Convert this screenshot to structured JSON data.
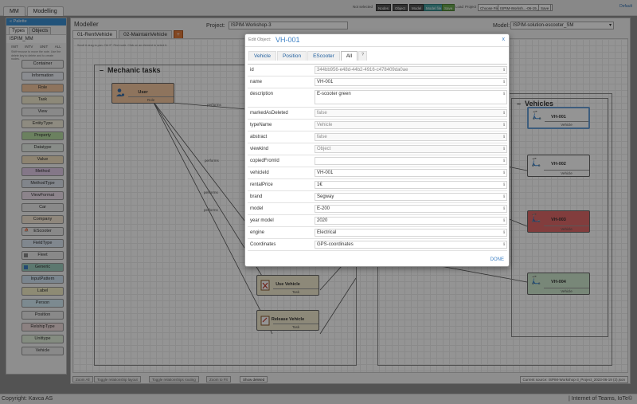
{
  "topbar": {
    "status": "Not selected",
    "buttons": [
      "Nodes",
      "Object",
      "Model",
      "Model file",
      "Save"
    ],
    "extras": [
      "Load",
      "Project",
      "Choose File"
    ],
    "file": "ISPIM-Worksh...-06-19_22.json",
    "last": "Save",
    "default": "Default"
  },
  "app_tabs": [
    "MM",
    "Modelling"
  ],
  "palette": {
    "header": "« Palette",
    "tabs": [
      "Types",
      "Objects"
    ],
    "title": "ISPIM_MM",
    "filters": [
      "INIT",
      "INTV",
      "UNIT",
      "ALL"
    ],
    "note": "Shift+mouse to move the note. Use the delete key to delete and to create nodes.",
    "items": [
      "Container",
      "Information",
      "Role",
      "Task",
      "View",
      "EntityType",
      "Property",
      "Datatype",
      "Value",
      "Method",
      "MethodType",
      "ViewFormat",
      "Car",
      "Company",
      "EScooter",
      "FieldType",
      "Fleet",
      "Generic",
      "InputPattern",
      "Label",
      "Person",
      "Position",
      "RelshipType",
      "Unittype",
      "Vehicle"
    ]
  },
  "modeller": {
    "title": "Modeller",
    "project_label": "Project:",
    "project": "ISPIM-Workshop-3",
    "model_label": "Model:",
    "model": "ISPIM-solution-escooter_SM",
    "tabs": [
      "01-RentVehicle",
      "02-MaintainVehicle",
      "+"
    ],
    "canvas_note": "Scroll & drag to pan. Ctrl+F: Find node. Click on an element to select it.",
    "mechanic_title": "Mechanic tasks",
    "vehicles_title": "Vehicles",
    "user_node": {
      "label": "User",
      "type": "Role"
    },
    "task_nodes": [
      {
        "label": "Use Vehicle",
        "type": "Task"
      },
      {
        "label": "Release Vehicle",
        "type": "Task"
      }
    ],
    "vehicle_nodes": [
      {
        "label": "VH-001",
        "type": "Vehicle"
      },
      {
        "label": "VH-002",
        "type": "Vehicle"
      },
      {
        "label": "VH-003",
        "type": "Vehicle"
      },
      {
        "label": "VH-004",
        "type": "Vehicle"
      }
    ],
    "edge_labels": [
      "performs",
      "performs",
      "performs",
      "performs"
    ],
    "bottom_buttons": [
      "Zoom All",
      "Toggle relationship layout",
      "Toggle relationships routing",
      "Zoom to Fit",
      "Show deleted"
    ],
    "source": "Current source: ISPIM-Workshop-3_Project_2023-06-19 (2).json"
  },
  "modal": {
    "subtitle": "Edit Object:",
    "title": "VH-001",
    "close": "x",
    "tabs": [
      "Vehicle",
      "Position",
      "EScooter",
      "All",
      "?"
    ],
    "done": "DONE",
    "properties": [
      {
        "name": "id",
        "value": "344bb956-e48d-44b2-4916-c478409da0ae"
      },
      {
        "name": "name",
        "value": "VH-001"
      },
      {
        "name": "description",
        "value": "E-scooter green"
      },
      {
        "name": "markedAsDeleted",
        "value": "false"
      },
      {
        "name": "typeName",
        "value": "Vehicle"
      },
      {
        "name": "abstract",
        "value": "false"
      },
      {
        "name": "viewkind",
        "value": "Object"
      },
      {
        "name": "copiedFromId",
        "value": ""
      },
      {
        "name": "vehicleId",
        "value": "VH-001"
      },
      {
        "name": "rentalPrice",
        "value": "1€"
      },
      {
        "name": "brand",
        "value": "Segway"
      },
      {
        "name": "model",
        "value": "E-200"
      },
      {
        "name": "year model",
        "value": "2020"
      },
      {
        "name": "engine",
        "value": "Electrical"
      },
      {
        "name": "Coordinates",
        "value": "GPS-coordinates"
      }
    ]
  },
  "footer": {
    "copyright": "Copyright: Kavca AS",
    "right": "| Internet of Teams, IoTe©"
  },
  "colors": {
    "accent": "#3b8fd3",
    "role": "#f5c9a0",
    "vehicle_red": "#e06a6a",
    "vehicle_green": "#cfe8cf",
    "task": "#f3ecd0"
  }
}
